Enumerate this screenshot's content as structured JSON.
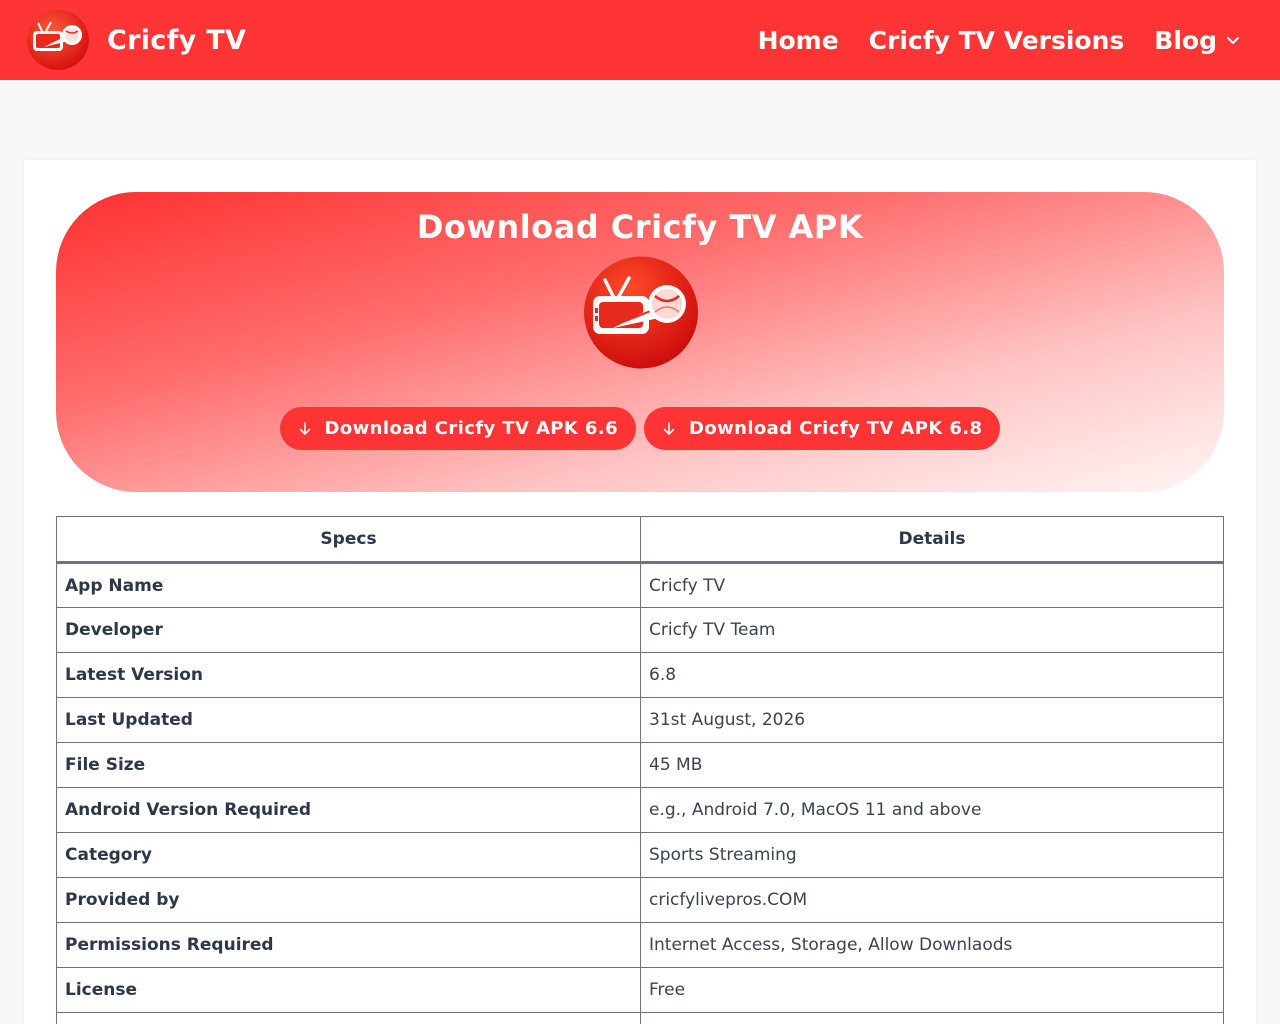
{
  "header": {
    "brand_name": "Cricfy TV",
    "nav": [
      {
        "label": "Home"
      },
      {
        "label": "Cricfy TV Versions"
      },
      {
        "label": "Blog"
      }
    ]
  },
  "hero": {
    "title": "Download Cricfy TV APK",
    "buttons": [
      {
        "label": "Download Cricfy TV APK 6.6",
        "icon": "arrow-down-icon"
      },
      {
        "label": "Download Cricfy TV APK 6.8",
        "icon": "arrow-down-icon"
      }
    ]
  },
  "table": {
    "headers": [
      "Specs",
      "Details"
    ],
    "rows": [
      {
        "key": "App Name",
        "value": "Cricfy TV"
      },
      {
        "key": "Developer",
        "value": "Cricfy TV Team"
      },
      {
        "key": "Latest Version",
        "value": "6.8"
      },
      {
        "key": "Last Updated",
        "value": "31st August, 2026"
      },
      {
        "key": "File Size",
        "value": "45 MB"
      },
      {
        "key": "Android Version Required",
        "value": "e.g., Android 7.0, MacOS 11 and above"
      },
      {
        "key": "Category",
        "value": "Sports Streaming"
      },
      {
        "key": "Provided by",
        "value": "cricfylivepros.COM"
      },
      {
        "key": "Permissions Required",
        "value": "Internet Access, Storage, Allow Downlaods"
      },
      {
        "key": "License",
        "value": "Free"
      }
    ]
  },
  "colors": {
    "brand_red": "#ff3535",
    "page_bg": "#f7f8fa"
  }
}
